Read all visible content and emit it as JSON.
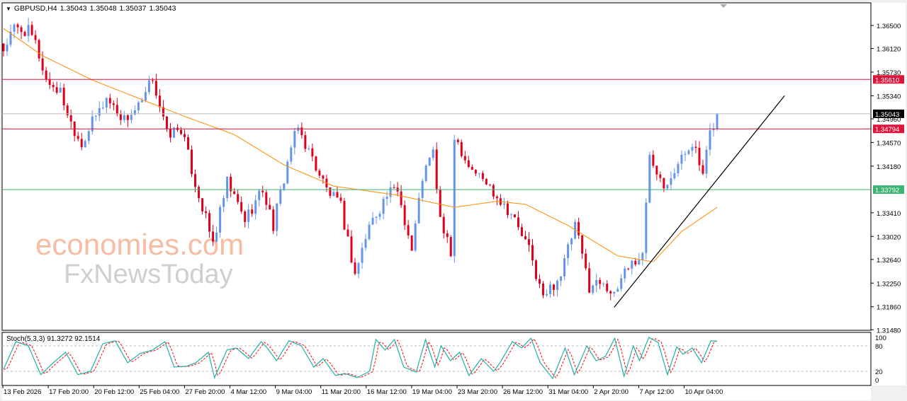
{
  "header": {
    "symbol": "GBPUSD,H4",
    "open": "1.35043",
    "high": "1.35048",
    "low": "1.35037",
    "close": "1.35043"
  },
  "stoch_label": "Stoch(5,3,3) 91.3272 92.1514",
  "watermark": {
    "line1": "economies.com",
    "line2": "FxNewsToday"
  },
  "colors": {
    "bull": "#6495ED",
    "bear": "#E0001B",
    "ma": "#FF8C00",
    "resistance": "#DC143C",
    "support": "#3CB371",
    "stoch_k": "#20B2AA",
    "stoch_d": "#FF0000"
  },
  "chart_data": {
    "type": "candlestick",
    "symbol": "GBPUSD",
    "timeframe": "H4",
    "ylim": [
      1.3148,
      1.3685
    ],
    "price_ticks": [
      "1.36500",
      "1.36120",
      "1.35730",
      "1.35340",
      "1.34960",
      "1.34570",
      "1.34180",
      "1.33410",
      "1.33020",
      "1.32640",
      "1.32250",
      "1.31860",
      "1.31480"
    ],
    "time_labels": [
      "13 Feb 2026",
      "17 Feb 20:00",
      "20 Feb 12:00",
      "25 Feb 04:00",
      "27 Feb 20:00",
      "4 Mar 12:00",
      "9 Mar 04:00",
      "11 Mar 20:00",
      "16 Mar 12:00",
      "19 Mar 04:00",
      "23 Mar 20:00",
      "26 Mar 12:00",
      "31 Mar 04:00",
      "2 Apr 20:00",
      "7 Apr 12:00",
      "10 Apr 04:00"
    ],
    "candle_count": 202,
    "close_waypoints": [
      [
        0,
        1.361
      ],
      [
        3,
        1.3645
      ],
      [
        7,
        1.364
      ],
      [
        9,
        1.362
      ],
      [
        12,
        1.356
      ],
      [
        16,
        1.354
      ],
      [
        19,
        1.349
      ],
      [
        22,
        1.3455
      ],
      [
        25,
        1.349
      ],
      [
        29,
        1.353
      ],
      [
        34,
        1.3495
      ],
      [
        39,
        1.352
      ],
      [
        42,
        1.3565
      ],
      [
        46,
        1.347
      ],
      [
        50,
        1.348
      ],
      [
        54,
        1.339
      ],
      [
        59,
        1.329
      ],
      [
        63,
        1.339
      ],
      [
        68,
        1.333
      ],
      [
        73,
        1.338
      ],
      [
        76,
        1.332
      ],
      [
        81,
        1.345
      ],
      [
        83,
        1.348
      ],
      [
        87,
        1.343
      ],
      [
        91,
        1.338
      ],
      [
        95,
        1.335
      ],
      [
        99,
        1.324
      ],
      [
        103,
        1.332
      ],
      [
        108,
        1.337
      ],
      [
        111,
        1.338
      ],
      [
        115,
        1.328
      ],
      [
        118,
        1.34
      ],
      [
        121,
        1.344
      ],
      [
        123,
        1.333
      ],
      [
        126,
        1.327
      ],
      [
        127,
        1.347
      ],
      [
        131,
        1.342
      ],
      [
        136,
        1.339
      ],
      [
        139,
        1.337
      ],
      [
        143,
        1.334
      ],
      [
        148,
        1.328
      ],
      [
        152,
        1.32
      ],
      [
        157,
        1.324
      ],
      [
        161,
        1.332
      ],
      [
        165,
        1.322
      ],
      [
        169,
        1.323
      ],
      [
        172,
        1.32
      ],
      [
        175,
        1.325
      ],
      [
        180,
        1.327
      ],
      [
        182,
        1.344
      ],
      [
        186,
        1.339
      ],
      [
        190,
        1.342
      ],
      [
        194,
        1.346
      ],
      [
        197,
        1.34
      ],
      [
        199,
        1.347
      ],
      [
        201,
        1.3504
      ]
    ],
    "ma_waypoints": [
      [
        0,
        1.3645
      ],
      [
        11,
        1.36
      ],
      [
        25,
        1.356
      ],
      [
        51,
        1.35
      ],
      [
        65,
        1.347
      ],
      [
        79,
        1.342
      ],
      [
        93,
        1.3385
      ],
      [
        111,
        1.337
      ],
      [
        127,
        1.335
      ],
      [
        139,
        1.336
      ],
      [
        147,
        1.3355
      ],
      [
        159,
        1.332
      ],
      [
        173,
        1.327
      ],
      [
        183,
        1.326
      ],
      [
        191,
        1.331
      ],
      [
        201,
        1.335
      ]
    ],
    "levels": [
      {
        "label": "1.35610",
        "price": 1.3561,
        "kind": "resistance"
      },
      {
        "label": "1.34794",
        "price": 1.34794,
        "kind": "resistance"
      },
      {
        "label": "1.33792",
        "price": 1.33792,
        "kind": "support"
      },
      {
        "label": "1.35043",
        "price": 1.35043,
        "kind": "current"
      }
    ],
    "trendline": {
      "from": [
        172,
        1.3185
      ],
      "to": [
        220,
        1.3534
      ]
    },
    "stochastic": {
      "params": "5,3,3",
      "k": 91.3272,
      "d": 92.1514,
      "levels": [
        20,
        80
      ],
      "axis_labels": [
        "100",
        "80",
        "20",
        "0"
      ],
      "k_waypoints": [
        [
          0,
          25
        ],
        [
          4,
          90
        ],
        [
          8,
          80
        ],
        [
          12,
          12
        ],
        [
          16,
          40
        ],
        [
          20,
          65
        ],
        [
          24,
          12
        ],
        [
          28,
          20
        ],
        [
          32,
          85
        ],
        [
          36,
          92
        ],
        [
          40,
          40
        ],
        [
          44,
          62
        ],
        [
          48,
          70
        ],
        [
          52,
          90
        ],
        [
          55,
          30
        ],
        [
          59,
          32
        ],
        [
          62,
          40
        ],
        [
          66,
          65
        ],
        [
          68,
          5
        ],
        [
          72,
          70
        ],
        [
          75,
          75
        ],
        [
          79,
          50
        ],
        [
          83,
          90
        ],
        [
          85,
          75
        ],
        [
          88,
          45
        ],
        [
          92,
          92
        ],
        [
          96,
          80
        ],
        [
          100,
          30
        ],
        [
          103,
          50
        ],
        [
          107,
          10
        ],
        [
          110,
          15
        ],
        [
          114,
          5
        ],
        [
          118,
          20
        ],
        [
          120,
          95
        ],
        [
          123,
          70
        ],
        [
          126,
          95
        ],
        [
          129,
          30
        ],
        [
          133,
          18
        ],
        [
          136,
          95
        ],
        [
          139,
          30
        ],
        [
          141,
          80
        ],
        [
          144,
          45
        ],
        [
          147,
          65
        ],
        [
          150,
          10
        ],
        [
          154,
          50
        ],
        [
          158,
          20
        ],
        [
          160,
          40
        ],
        [
          164,
          90
        ],
        [
          167,
          75
        ],
        [
          170,
          98
        ],
        [
          173,
          40
        ],
        [
          177,
          3
        ],
        [
          181,
          75
        ],
        [
          184,
          12
        ],
        [
          188,
          80
        ],
        [
          191,
          45
        ],
        [
          194,
          55
        ],
        [
          197,
          98
        ],
        [
          200,
          8
        ],
        [
          203,
          80
        ],
        [
          205,
          45
        ],
        [
          208,
          100
        ],
        [
          211,
          88
        ],
        [
          214,
          12
        ],
        [
          217,
          78
        ],
        [
          219,
          60
        ],
        [
          222,
          75
        ],
        [
          225,
          40
        ],
        [
          228,
          92
        ],
        [
          230,
          91
        ]
      ]
    }
  }
}
